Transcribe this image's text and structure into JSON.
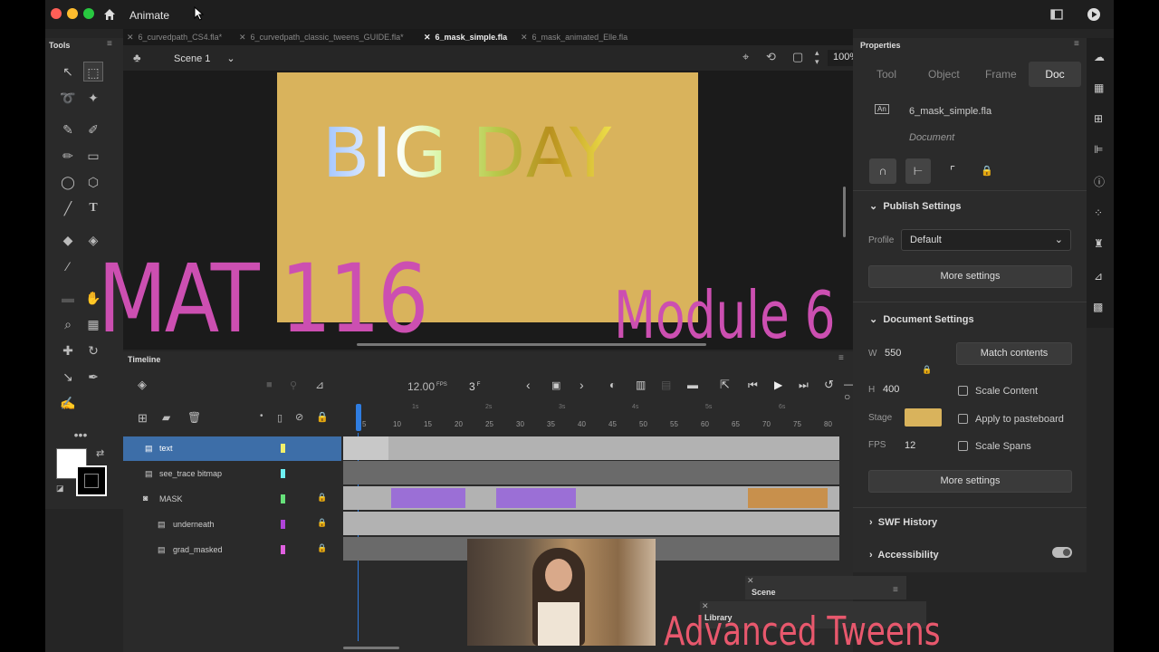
{
  "app": {
    "title": "Animate"
  },
  "doc_tabs": [
    "6_curvedpath_CS4.fla*",
    "6_curvedpath_classic_tweens_GUIDE.fla*",
    "6_mask_simple.fla",
    "6_mask_animated_Elle.fla"
  ],
  "tools_panel": {
    "title": "Tools"
  },
  "stage_bar": {
    "scene": "Scene 1",
    "zoom": "100%"
  },
  "stage": {
    "text": "BIG DAY"
  },
  "overlays": {
    "course": "MAT 116",
    "module": "Module 6",
    "topic": "Advanced Tweens"
  },
  "timeline": {
    "title": "Timeline",
    "fps": "12.00",
    "fps_unit": "FPS",
    "frame": "3",
    "frame_unit": "F",
    "ruler": [
      "5",
      "10",
      "15",
      "20",
      "25",
      "30",
      "35",
      "40",
      "45",
      "50",
      "55",
      "60",
      "65",
      "70",
      "75",
      "80"
    ],
    "ruler_seconds": [
      "1s",
      "2s",
      "3s",
      "4s",
      "5s",
      "6s"
    ],
    "layers": [
      {
        "name": "text",
        "color": "#f2f06a",
        "locked": false,
        "selected": true
      },
      {
        "name": "see_trace bitmap",
        "color": "#6ef0f2",
        "locked": false,
        "selected": false
      },
      {
        "name": "MASK",
        "color": "#66e07a",
        "locked": true,
        "selected": false
      },
      {
        "name": "underneath",
        "color": "#b044d9",
        "locked": true,
        "selected": false
      },
      {
        "name": "grad_masked",
        "color": "#e060e0",
        "locked": true,
        "selected": false
      }
    ]
  },
  "properties": {
    "title": "Properties",
    "tabs": [
      "Tool",
      "Object",
      "Frame",
      "Doc"
    ],
    "active_tab": "Doc",
    "filename": "6_mask_simple.fla",
    "doc_label": "Document",
    "publish_settings": {
      "heading": "Publish Settings",
      "profile_label": "Profile",
      "profile_value": "Default",
      "more": "More settings"
    },
    "document_settings": {
      "heading": "Document Settings",
      "w_label": "W",
      "w_value": "550",
      "h_label": "H",
      "h_value": "400",
      "match": "Match contents",
      "scale_content": "Scale Content",
      "stage_label": "Stage",
      "stage_color": "#d9b35c",
      "apply_pasteboard": "Apply to pasteboard",
      "fps_label": "FPS",
      "fps_value": "12",
      "scale_spans": "Scale Spans",
      "more": "More settings"
    },
    "swf_history": "SWF History",
    "accessibility": "Accessibility"
  },
  "scene_panel": {
    "title": "Scene"
  },
  "library_panel": {
    "title": "Library"
  }
}
